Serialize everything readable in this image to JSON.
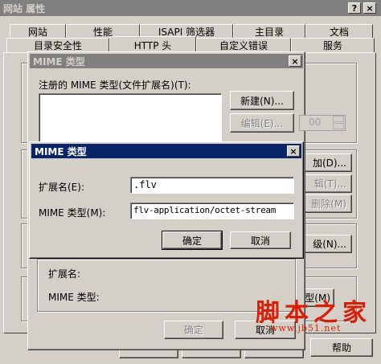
{
  "main_window": {
    "title": "网站 属性",
    "help_btn": "?",
    "close_btn": "×",
    "tabs_row1": [
      "网站",
      "性能",
      "ISAPI 筛选器",
      "主目录",
      "文档"
    ],
    "tabs_row2": [
      "目录安全性",
      "HTTP 头",
      "自定义错误",
      "服务"
    ],
    "bottom_buttons": {
      "help": "帮助"
    }
  },
  "mime_types_dialog": {
    "title": "MIME 类型",
    "close_btn": "×",
    "registered_label": "注册的 MIME 类型(文件扩展名)(T):",
    "new_button": "新建(N)...",
    "edit_button": "编辑(E)...",
    "spinner_value": "00",
    "extension_label": "扩展名:",
    "mime_label": "MIME 类型:",
    "ok_button": "确定",
    "cancel_button": "取消"
  },
  "background_buttons": {
    "add": "加(D)...",
    "edit": "辑(T)...",
    "remove": "删除(M)",
    "level": "级(N)...",
    "type": "类型(M)"
  },
  "edit_dialog": {
    "title": "MIME 类型",
    "close_btn": "×",
    "extension_label": "扩展名(E):",
    "extension_value": ".flv",
    "mime_label": "MIME 类型(M):",
    "mime_value": "flv-application/octet-stream",
    "ok_button": "确定",
    "cancel_button": "取消"
  },
  "watermark": {
    "brand": "脚本之家",
    "url": "www.jb51.net",
    "color": "#d81e06"
  }
}
